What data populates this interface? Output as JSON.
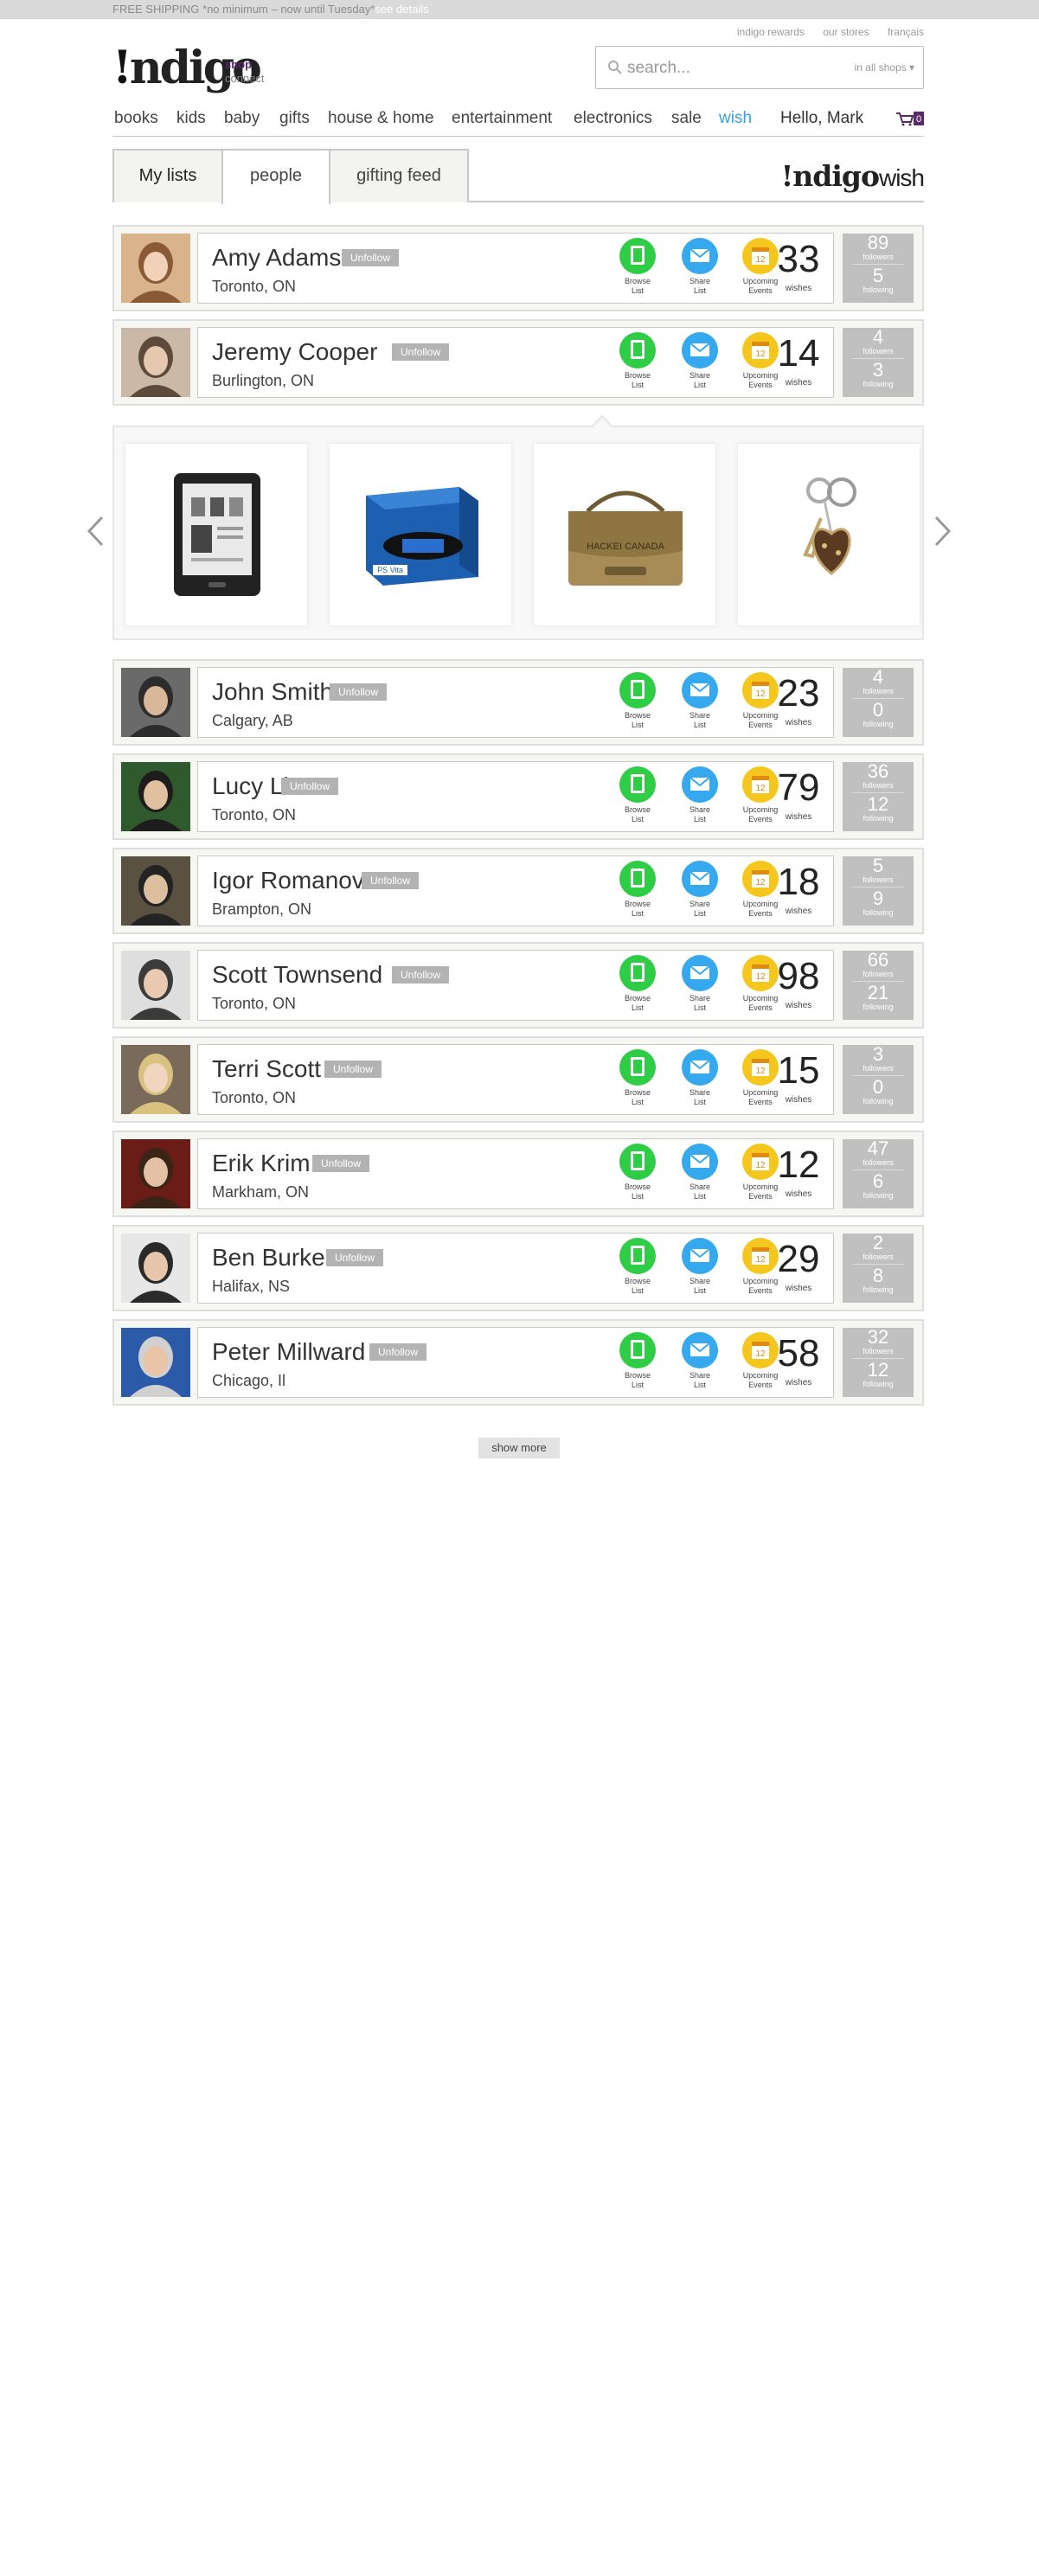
{
  "promo": {
    "text": "FREE SHIPPING *no minimum – now until Tuesday*",
    "link": "see details"
  },
  "top_links": [
    "indigo rewards",
    "our stores",
    "français"
  ],
  "logo": {
    "text": "ndigo",
    "bang": "!"
  },
  "shop_connect": {
    "shop": "shop",
    "connect": "connect"
  },
  "search": {
    "placeholder": "search...",
    "scope": "in all shops ▾"
  },
  "nav": [
    "books",
    "kids",
    "baby",
    "gifts",
    "house & home",
    "entertainment",
    "electronics",
    "sale",
    "wish",
    "Hello, Mark"
  ],
  "cart": {
    "count": "0"
  },
  "tabs": [
    "My lists",
    "people",
    "gifting feed"
  ],
  "brand": {
    "indigo": "!ndigo",
    "wish": "wish"
  },
  "actions": {
    "browse": [
      "Browse",
      "List"
    ],
    "share": [
      "Share",
      "List"
    ],
    "events": [
      "Upcoming",
      "Events"
    ],
    "calendar_day": "12"
  },
  "labels": {
    "unfollow": "Unfollow",
    "wishes": "wishes",
    "followers": "followers",
    "following": "following"
  },
  "people": [
    {
      "name": "Amy Adams",
      "location": "Toronto, ON",
      "wishes": "33",
      "followers": "89",
      "following": "5"
    },
    {
      "name": "Jeremy Cooper",
      "location": "Burlington, ON",
      "wishes": "14",
      "followers": "4",
      "following": "3"
    },
    {
      "name": "John Smith",
      "location": "Calgary, AB",
      "wishes": "23",
      "followers": "4",
      "following": "0"
    },
    {
      "name": "Lucy Li",
      "location": "Toronto, ON",
      "wishes": "79",
      "followers": "36",
      "following": "12"
    },
    {
      "name": "Igor Romanov",
      "location": "Brampton, ON",
      "wishes": "18",
      "followers": "5",
      "following": "9"
    },
    {
      "name": "Scott Townsend",
      "location": "Toronto, ON",
      "wishes": "98",
      "followers": "66",
      "following": "21"
    },
    {
      "name": "Terri Scott",
      "location": "Toronto, ON",
      "wishes": "15",
      "followers": "3",
      "following": "0"
    },
    {
      "name": "Erik Krim",
      "location": "Markham, ON",
      "wishes": "12",
      "followers": "47",
      "following": "6"
    },
    {
      "name": "Ben Burke",
      "location": "Halifax, NS",
      "wishes": "29",
      "followers": "2",
      "following": "8"
    },
    {
      "name": "Peter Millward",
      "location": "Chicago, Il",
      "wishes": "58",
      "followers": "32",
      "following": "12"
    }
  ],
  "carousel": {
    "bag_text": "HACKEI CANADA",
    "console_text": "PS Vita"
  },
  "show_more": "show more",
  "colors": {
    "browse": "#2fcc45",
    "share": "#35a8ee",
    "events": "#f5c61d",
    "wish_link": "#3aa0d8",
    "stats_bg": "#c0c0c0"
  }
}
